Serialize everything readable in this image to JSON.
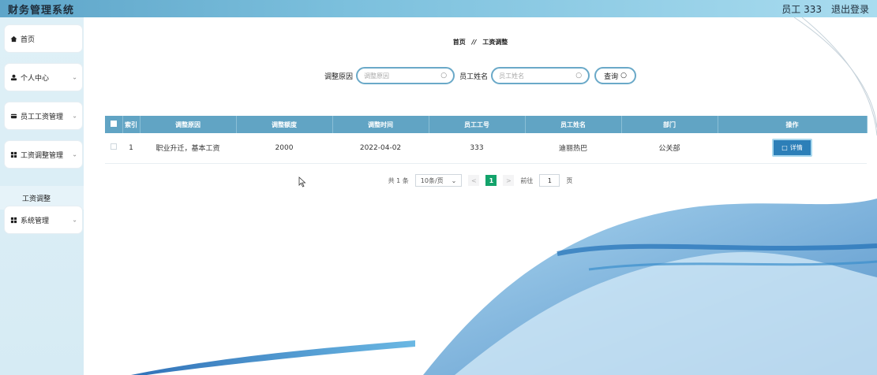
{
  "app": {
    "title": "财务管理系统"
  },
  "header": {
    "user_label": "员工 333",
    "logout_label": "退出登录"
  },
  "sidebar": {
    "items": [
      {
        "label": "首页",
        "icon": "home-icon",
        "has_chevron": false
      },
      {
        "label": "个人中心",
        "icon": "user-icon",
        "has_chevron": true
      },
      {
        "label": "员工工资管理",
        "icon": "wallet-icon",
        "has_chevron": true
      },
      {
        "label": "工资调整管理",
        "icon": "grid-icon",
        "has_chevron": true
      },
      {
        "label": "系统管理",
        "icon": "grid-icon",
        "has_chevron": true
      }
    ],
    "submenu_label": "工资调整"
  },
  "breadcrumb": {
    "home": "首页",
    "separator": "//",
    "current": "工资调整"
  },
  "search": {
    "reason_label": "调整原因",
    "reason_placeholder": "调整原因",
    "name_label": "员工姓名",
    "name_placeholder": "员工姓名",
    "query_label": "查询"
  },
  "table": {
    "headers": [
      "索引",
      "调整原因",
      "调整额度",
      "调整时间",
      "员工工号",
      "员工姓名",
      "部门",
      "操作"
    ],
    "rows": [
      {
        "index": "1",
        "reason": "职业升迁，基本工资",
        "amount": "2000",
        "time": "2022-04-02",
        "employee_no": "333",
        "employee_name": "迪丽热巴",
        "department": "公关部",
        "action_label": "详情"
      }
    ]
  },
  "pagination": {
    "total_text": "共 1 条",
    "page_size": "10条/页",
    "current_page": "1",
    "goto_label": "前往",
    "goto_value": "1",
    "page_suffix": "页"
  },
  "colors": {
    "header_start": "#5ea5c9",
    "table_header": "#61a4c4",
    "active_page": "#13a36b",
    "detail_button": "#2c7fb8",
    "wave": "#2f86c8"
  }
}
